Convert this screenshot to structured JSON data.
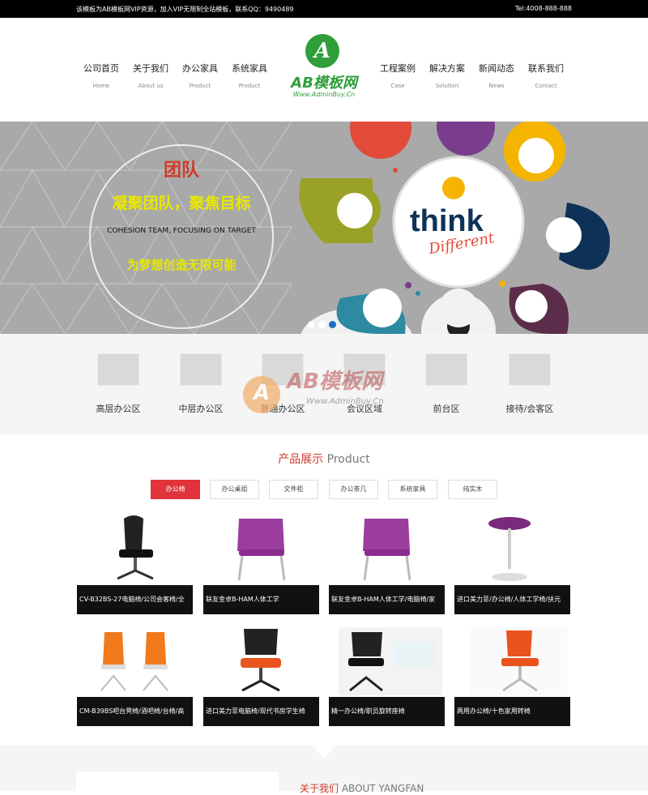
{
  "topbar": {
    "left": "该模板为AB模板网VIP资源，加入VIP无限制全站模板，联系QQ：9490489",
    "right": "Tel:4008-888-888"
  },
  "nav": [
    {
      "cn": "公司首页",
      "en": "Home"
    },
    {
      "cn": "关于我们",
      "en": "About us"
    },
    {
      "cn": "办公家具",
      "en": "Product"
    },
    {
      "cn": "系统家具",
      "en": "Product"
    },
    {
      "cn": "工程案例",
      "en": "Case"
    },
    {
      "cn": "解决方案",
      "en": "Solution"
    },
    {
      "cn": "新闻动态",
      "en": "News"
    },
    {
      "cn": "联系我们",
      "en": "Contact"
    }
  ],
  "logo": {
    "letter": "A",
    "name": "AB模板网",
    "url": "Www.AdminBuy.Cn"
  },
  "banner": {
    "t1": "团队",
    "t2": "凝聚团队，聚焦目标",
    "t3": "COHESION TEAM, FOCUSING ON TARGET",
    "t4": "为梦想创造无限可能",
    "think": "think",
    "different": "Different"
  },
  "categories": [
    "高层办公区",
    "中层办公区",
    "普通办公区",
    "会议区域",
    "前台区",
    "接待/会客区"
  ],
  "watermark": {
    "letter": "A",
    "name": "AB模板网",
    "url": "Www.AdminBuy.Cn"
  },
  "products_title": {
    "cn": "产品展示",
    "en": "Product"
  },
  "tabs": [
    "办公椅",
    "办公桌组",
    "文件柜",
    "办公茶几",
    "系统家具",
    "纯实木"
  ],
  "products": [
    "CV-B32BS-27电脑椅/公司会客椅/全",
    "联友金卓B-HAM人体工学",
    "联友金卓B-HAM人体工学/电脑椅/家",
    "进口美力菲/办公椅/人体工学椅/扶元",
    "CM-B39BS吧台凳椅/酒吧椅/台椅/高",
    "进口美力菲电脑椅/现代书房学生椅",
    "精一办公椅/职员旋转座椅",
    "两用办公椅/十色家用转椅"
  ],
  "about": {
    "cn": "关于我们",
    "en": "ABOUT YANGFAN"
  },
  "colors": {
    "accent": "#e0333a",
    "brand_green": "#2f9e3b",
    "banner_gray": "#a9a9a9"
  }
}
